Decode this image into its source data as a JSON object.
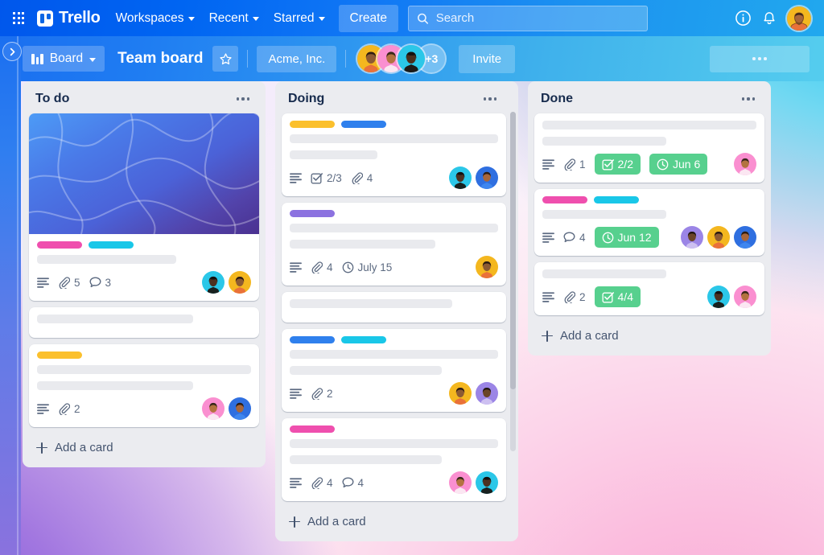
{
  "topbar": {
    "apps_icon": "grid-apps-icon",
    "brand": "Trello",
    "nav": [
      {
        "label": "Workspaces",
        "has_chevron": true
      },
      {
        "label": "Recent",
        "has_chevron": true
      },
      {
        "label": "Starred",
        "has_chevron": true
      }
    ],
    "create_label": "Create",
    "search": {
      "placeholder": "Search",
      "value": "",
      "icon": "search-icon"
    },
    "info_icon": "info-circle-icon",
    "notification_icon": "bell-icon",
    "account_avatar": "user-avatar"
  },
  "boardbar": {
    "sidebar_toggle_icon": "chevron-right-icon",
    "view_label": "Board",
    "view_icon": "board-columns-icon",
    "view_chevron": "chevron-down-icon",
    "title": "Team board",
    "star_icon": "star-outline-icon",
    "workspace": "Acme, Inc.",
    "members_overflow": "+3",
    "invite_label": "Invite",
    "more_icon": "ellipsis-icon"
  },
  "colors": {
    "brand_blue": "#0b66e4",
    "label_pink": "#ef4fae",
    "label_cyan": "#19c7e8",
    "label_yellow": "#fbc02d",
    "label_blue": "#2f80ed",
    "label_purple": "#8c72e0",
    "badge_green": "#57d08e",
    "list_bg": "#ebecf0",
    "card_bg": "#ffffff"
  },
  "lists": [
    {
      "title": "To do",
      "menu_icon": "ellipsis-icon",
      "add_card_label": "Add a card",
      "has_scrollbar": false,
      "cards": [
        {
          "cover": "blue-purple-waves-cover",
          "labels": [
            "label_pink",
            "label_cyan"
          ],
          "skeleton_widths": [
            "65%"
          ],
          "badges": [
            {
              "icon": "description-icon",
              "text": ""
            },
            {
              "icon": "attachment-icon",
              "text": "5"
            },
            {
              "icon": "comment-icon",
              "text": "3"
            }
          ],
          "avatars": [
            "cyan",
            "yellow"
          ]
        },
        {
          "cover": null,
          "labels": [],
          "skeleton_widths": [
            "73%"
          ],
          "badges": [],
          "avatars": []
        },
        {
          "cover": null,
          "labels": [
            "label_yellow"
          ],
          "skeleton_widths": [
            "100%",
            "73%"
          ],
          "badges": [
            {
              "icon": "description-icon",
              "text": ""
            },
            {
              "icon": "attachment-icon",
              "text": "2"
            }
          ],
          "avatars": [
            "pink",
            "blue"
          ]
        }
      ]
    },
    {
      "title": "Doing",
      "menu_icon": "ellipsis-icon",
      "add_card_label": "Add a card",
      "has_scrollbar": true,
      "cards": [
        {
          "cover": null,
          "labels": [
            "label_yellow",
            "label_blue"
          ],
          "skeleton_widths": [
            "100%",
            "42%"
          ],
          "badges": [
            {
              "icon": "description-icon",
              "text": ""
            },
            {
              "icon": "checklist-icon",
              "text": "2/3"
            },
            {
              "icon": "attachment-icon",
              "text": "4"
            }
          ],
          "avatars": [
            "cyan",
            "blue"
          ]
        },
        {
          "cover": null,
          "labels": [
            "label_purple"
          ],
          "skeleton_widths": [
            "100%",
            "70%"
          ],
          "badges": [
            {
              "icon": "description-icon",
              "text": ""
            },
            {
              "icon": "attachment-icon",
              "text": "4"
            },
            {
              "icon": "clock-icon",
              "text": "July 15"
            }
          ],
          "avatars": [
            "yellow"
          ]
        },
        {
          "cover": null,
          "labels": [],
          "skeleton_widths": [
            "78%"
          ],
          "badges": [],
          "avatars": []
        },
        {
          "cover": null,
          "labels": [
            "label_blue",
            "label_cyan"
          ],
          "skeleton_widths": [
            "100%",
            "73%"
          ],
          "badges": [
            {
              "icon": "description-icon",
              "text": ""
            },
            {
              "icon": "attachment-icon",
              "text": "2"
            }
          ],
          "avatars": [
            "yellow",
            "purple"
          ]
        },
        {
          "cover": null,
          "labels": [
            "label_pink"
          ],
          "skeleton_widths": [
            "100%",
            "73%"
          ],
          "badges": [
            {
              "icon": "description-icon",
              "text": ""
            },
            {
              "icon": "attachment-icon",
              "text": "4"
            },
            {
              "icon": "comment-icon",
              "text": "4"
            }
          ],
          "avatars": [
            "pink",
            "cyan"
          ]
        }
      ]
    },
    {
      "title": "Done",
      "menu_icon": "ellipsis-icon",
      "add_card_label": "Add a card",
      "has_scrollbar": false,
      "cards": [
        {
          "cover": null,
          "labels": [],
          "skeleton_widths": [
            "100%",
            "58%"
          ],
          "badges": [
            {
              "icon": "description-icon",
              "text": ""
            },
            {
              "icon": "attachment-icon",
              "text": "1"
            },
            {
              "icon": "checklist-icon",
              "text": "2/2",
              "pill": true
            },
            {
              "icon": "clock-icon",
              "text": "Jun 6",
              "pill": true
            }
          ],
          "avatars": [
            "pink"
          ]
        },
        {
          "cover": null,
          "labels": [
            "label_pink",
            "label_cyan"
          ],
          "skeleton_widths": [
            "58%"
          ],
          "badges": [
            {
              "icon": "description-icon",
              "text": ""
            },
            {
              "icon": "comment-icon",
              "text": "4"
            },
            {
              "icon": "clock-icon",
              "text": "Jun 12",
              "pill": true
            }
          ],
          "avatars": [
            "purple",
            "yellow",
            "blue"
          ]
        },
        {
          "cover": null,
          "labels": [],
          "skeleton_widths": [
            "58%"
          ],
          "badges": [
            {
              "icon": "description-icon",
              "text": ""
            },
            {
              "icon": "attachment-icon",
              "text": "2"
            },
            {
              "icon": "checklist-icon",
              "text": "4/4",
              "pill": true
            }
          ],
          "avatars": [
            "cyan",
            "pink"
          ]
        }
      ]
    }
  ]
}
